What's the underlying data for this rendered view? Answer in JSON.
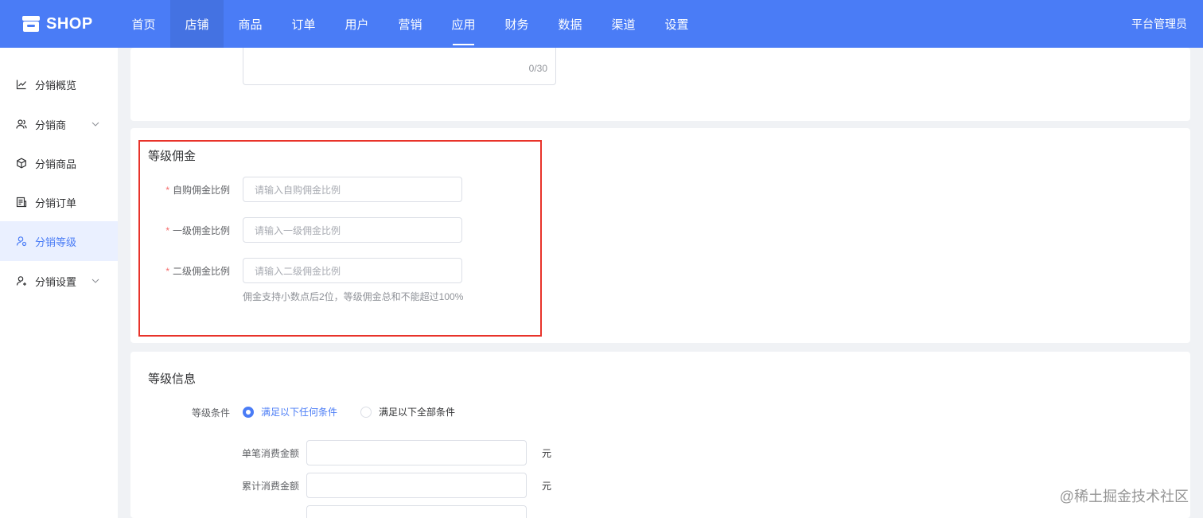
{
  "header": {
    "brand": "SHOP",
    "nav": [
      "首页",
      "店铺",
      "商品",
      "订单",
      "用户",
      "营销",
      "应用",
      "财务",
      "数据",
      "渠道",
      "设置"
    ],
    "active_nav": "店铺",
    "underlined_nav": "应用",
    "admin": "平台管理员"
  },
  "sidebar": {
    "items": [
      {
        "label": "分销概览",
        "icon": "chart-line-icon"
      },
      {
        "label": "分销商",
        "icon": "users-icon",
        "expandable": true
      },
      {
        "label": "分销商品",
        "icon": "box-icon"
      },
      {
        "label": "分销订单",
        "icon": "receipt-icon"
      },
      {
        "label": "分销等级",
        "icon": "user-level-icon",
        "active": true
      },
      {
        "label": "分销设置",
        "icon": "user-settings-icon",
        "expandable": true
      }
    ]
  },
  "top_card": {
    "textarea_count": "0/30"
  },
  "commission": {
    "title": "等级佣金",
    "fields": [
      {
        "label": "自购佣金比例",
        "placeholder": "请输入自购佣金比例",
        "required": true
      },
      {
        "label": "一级佣金比例",
        "placeholder": "请输入一级佣金比例",
        "required": true
      },
      {
        "label": "二级佣金比例",
        "placeholder": "请输入二级佣金比例",
        "required": true
      }
    ],
    "required_mark": "*",
    "hint": "佣金支持小数点后2位，等级佣金总和不能超过100%"
  },
  "level_info": {
    "title": "等级信息",
    "condition_label": "等级条件",
    "options": [
      "满足以下任何条件",
      "满足以下全部条件"
    ],
    "selected_option": "满足以下任何条件",
    "rows": [
      {
        "label": "单笔消费金额",
        "unit": "元"
      },
      {
        "label": "累计消费金额",
        "unit": "元"
      }
    ]
  },
  "watermark": "@稀土掘金技术社区",
  "colors": {
    "primary": "#4a7cf6",
    "highlight_border": "#e8332a",
    "required": "#f56c6c"
  }
}
